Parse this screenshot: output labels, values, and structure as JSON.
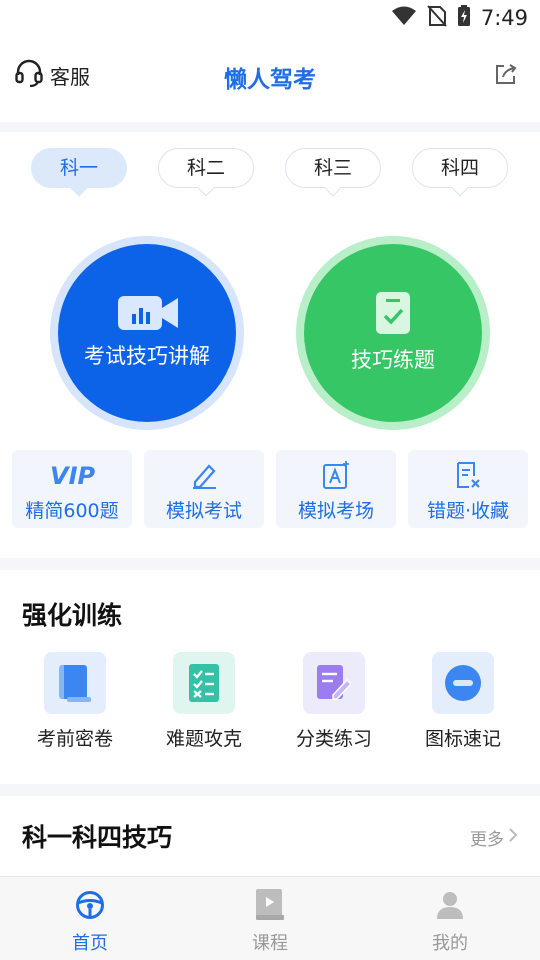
{
  "status_bar": {
    "time": "7:49"
  },
  "header": {
    "service_label": "客服",
    "title": "懒人驾考"
  },
  "subject_tabs": [
    {
      "label": "科一",
      "active": true
    },
    {
      "label": "科二",
      "active": false
    },
    {
      "label": "科三",
      "active": false
    },
    {
      "label": "科四",
      "active": false
    }
  ],
  "main_actions": {
    "skills_video": {
      "label": "考试技巧讲解",
      "color": "#0c63e7"
    },
    "skills_practice": {
      "label": "技巧练题",
      "color": "#37c665"
    }
  },
  "features": [
    {
      "label": "精简600题",
      "icon": "vip-icon"
    },
    {
      "label": "模拟考试",
      "icon": "pencil-icon"
    },
    {
      "label": "模拟考场",
      "icon": "exam-room-icon"
    },
    {
      "label": "错题·收藏",
      "icon": "wrong-questions-icon"
    }
  ],
  "training": {
    "title": "强化训练",
    "items": [
      {
        "label": "考前密卷",
        "icon": "scroll-icon"
      },
      {
        "label": "难题攻克",
        "icon": "checklist-icon"
      },
      {
        "label": "分类练习",
        "icon": "edit-note-icon"
      },
      {
        "label": "图标速记",
        "icon": "sign-icon"
      }
    ]
  },
  "tips_section": {
    "title": "科一科四技巧",
    "more_label": "更多"
  },
  "bottom_nav": [
    {
      "label": "首页",
      "active": true,
      "icon": "steering-wheel-icon"
    },
    {
      "label": "课程",
      "active": false,
      "icon": "course-icon"
    },
    {
      "label": "我的",
      "active": false,
      "icon": "profile-icon"
    }
  ],
  "colors": {
    "primary": "#1e6fe6",
    "green": "#37c665",
    "background_gray": "#f4f6f9"
  }
}
